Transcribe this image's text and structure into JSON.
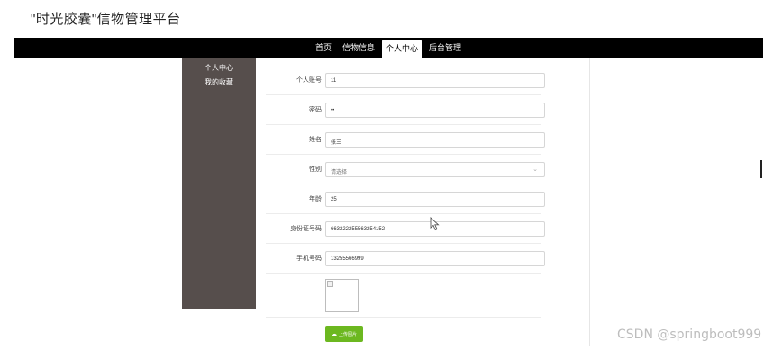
{
  "site": {
    "title": "\"时光胶囊\"信物管理平台"
  },
  "nav": {
    "items": [
      {
        "label": "首页",
        "active": false
      },
      {
        "label": "信物信息",
        "active": false
      },
      {
        "label": "个人中心",
        "active": true
      },
      {
        "label": "后台管理",
        "active": false
      }
    ]
  },
  "sidebar": {
    "items": [
      {
        "label": "个人中心"
      },
      {
        "label": "我的收藏"
      }
    ]
  },
  "form": {
    "fields": [
      {
        "label": "个人账号",
        "value": "11"
      },
      {
        "label": "密码",
        "value": "••"
      },
      {
        "label": "姓名",
        "value": "张三"
      },
      {
        "label": "性别",
        "value": "请选择",
        "type": "select"
      },
      {
        "label": "年龄",
        "value": "25"
      },
      {
        "label": "身份证号码",
        "value": "663222255563254152"
      },
      {
        "label": "手机号码",
        "value": "13255566999"
      }
    ],
    "upload_label": "上传图片",
    "upload_icon": "upload-icon"
  },
  "watermark": "CSDN @springboot999",
  "colors": {
    "nav_bg": "#000000",
    "sidebar_bg": "#564e4c",
    "upload_btn": "#6cb820"
  }
}
